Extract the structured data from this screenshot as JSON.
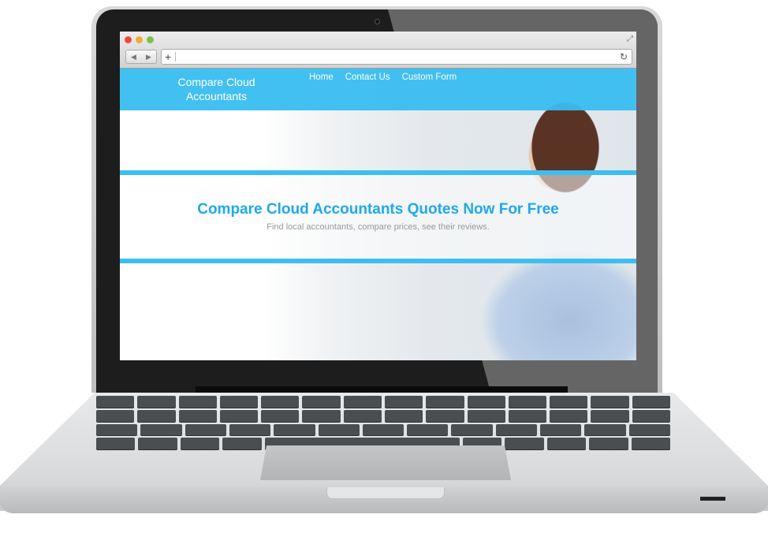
{
  "browser": {
    "window_controls": [
      "close",
      "minimize",
      "maximize"
    ],
    "back_icon": "◀",
    "forward_icon": "▶",
    "new_tab_icon": "+",
    "reload_icon": "↻",
    "fullscreen_icon": "⤢",
    "address_value": ""
  },
  "site": {
    "brand_line1": "Compare Cloud",
    "brand_line2": "Accountants",
    "nav": [
      {
        "label": "Home"
      },
      {
        "label": "Contact Us"
      },
      {
        "label": "Custom Form"
      }
    ],
    "hero": {
      "title": "Compare Cloud Accountants Quotes Now For Free",
      "subtitle": "Find local accountants, compare prices, see their reviews."
    },
    "accent_color": "#3cbff0",
    "title_color": "#1ea9e8"
  }
}
